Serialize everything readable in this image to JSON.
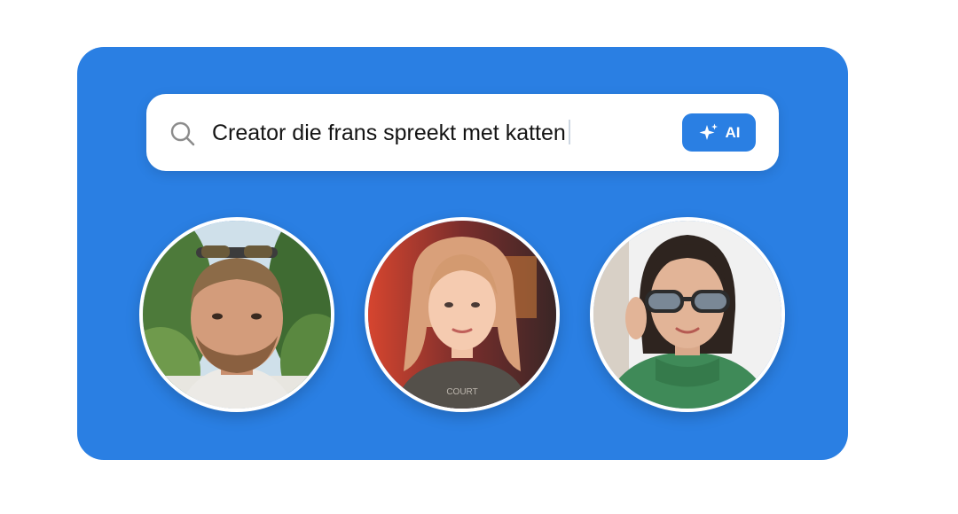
{
  "search": {
    "value": "Creator die frans spreekt met katten",
    "icon": "search-icon"
  },
  "ai_button": {
    "label": "AI",
    "icon": "sparkles-icon"
  },
  "creators": [
    {
      "avatar": "creator-avatar-1",
      "hoodie_text": ""
    },
    {
      "avatar": "creator-avatar-2",
      "hoodie_text": "COURT"
    },
    {
      "avatar": "creator-avatar-3",
      "hoodie_text": ""
    }
  ],
  "colors": {
    "panel": "#2a7fe3",
    "search_bg": "#ffffff",
    "button": "#2a7fe3"
  }
}
